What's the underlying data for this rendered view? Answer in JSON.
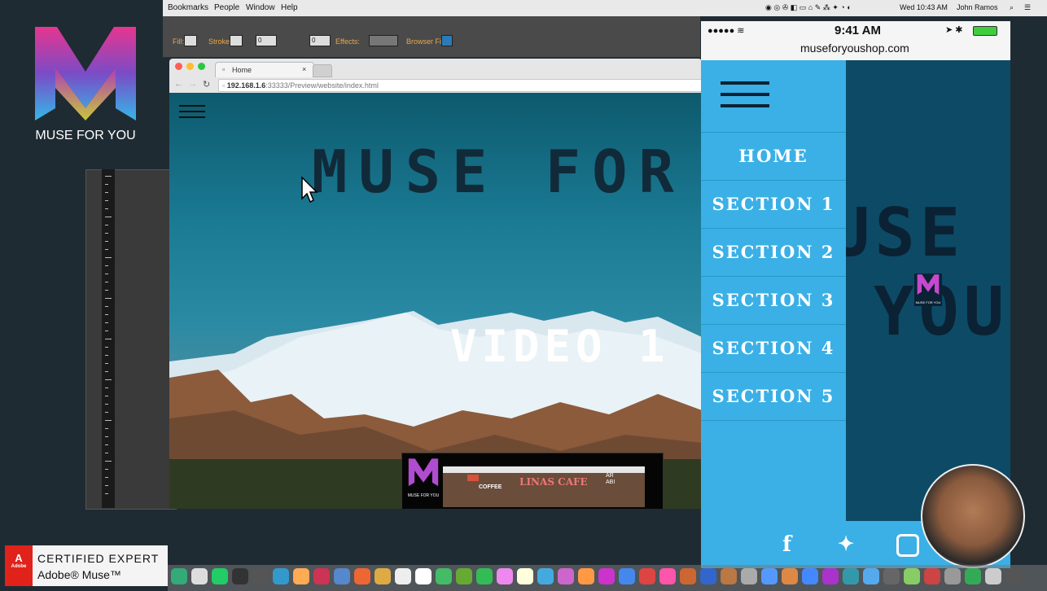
{
  "menubar": {
    "items": [
      "Bookmarks",
      "People",
      "Window",
      "Help"
    ],
    "clock": "Wed 10:43 AM",
    "user": "John Ramos"
  },
  "muse_toolbar": {
    "fill_label": "Fill:",
    "stroke_label": "Stroke:",
    "stroke_value": "0",
    "size_value": "0",
    "effects_label": "Effects:",
    "browser_fill_label": "Browser Fill:"
  },
  "logo": {
    "caption": "MUSE FOR YOU"
  },
  "browser": {
    "tab_title": "Home",
    "url_host": "192.168.1.6",
    "url_rest": ":33333/Preview/website/index.html",
    "site_title": "MUSE FOR YO",
    "video_label": "VIDEO 1"
  },
  "phone": {
    "time": "9:41 AM",
    "url": "museforyoushop.com",
    "menu": [
      "HOME",
      "SECTION 1",
      "SECTION 2",
      "SECTION 3",
      "SECTION 4",
      "SECTION 5"
    ],
    "bg_text_line1": "USE",
    "bg_text_line2": "YOU",
    "mini_logo_caption": "MUSE FOR YOU",
    "social": [
      "facebook-icon",
      "twitter-icon",
      "instagram-icon"
    ]
  },
  "thumbnail": {
    "caption": "MUSE FOR YOU",
    "cafe_title": "LINAS CAFE",
    "coffee_label": "COFFEE",
    "side_text": "ARABI"
  },
  "badge": {
    "adobe": "Adobe",
    "line1": "CERTIFIED EXPERT",
    "line2": "Adobe® Muse™"
  },
  "colors": {
    "menu_blue": "#3ab0e6",
    "phone_dark": "#0d4a66",
    "sky": "#1a7993",
    "adobe_red": "#e0221b"
  }
}
